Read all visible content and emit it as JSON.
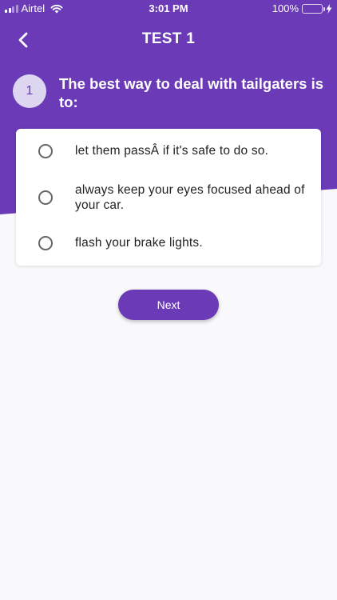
{
  "status_bar": {
    "carrier": "Airtel",
    "time": "3:01 PM",
    "battery_percent": "100%",
    "battery_level": 1.0,
    "battery_color": "#4cd964"
  },
  "nav": {
    "title": "TEST 1",
    "back_icon": "chevron-left-icon"
  },
  "question": {
    "number": "1",
    "text": "The best way to deal with tailgaters is to:"
  },
  "options": [
    {
      "label": "let them passÂ if it's safe to do so.",
      "selected": false
    },
    {
      "label": "always keep your eyes focused ahead of your car.",
      "selected": false
    },
    {
      "label": "flash your brake lights.",
      "selected": false
    }
  ],
  "next_button": {
    "label": "Next"
  },
  "colors": {
    "primary": "#6a3ab7",
    "question_badge_bg": "#ddd6f1",
    "background": "#f9f9fb"
  }
}
